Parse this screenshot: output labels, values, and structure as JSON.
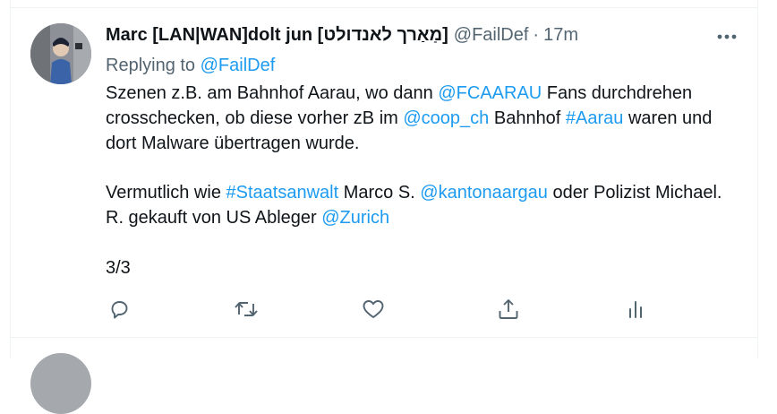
{
  "tweet": {
    "display_name": "Marc [LAN|WAN]dolt jun [מַאַרך לאנדולט]",
    "handle": "@FailDef",
    "separator": "·",
    "time": "17m",
    "replying_prefix": "Replying to",
    "replying_to": "@FailDef",
    "paragraph1": {
      "t1": "Szenen z.B. am Bahnhof Aarau, wo dann ",
      "m1": "@FCAARAU",
      "t2": " Fans durchdrehen crosschecken, ob diese vorher zB im ",
      "m2": "@coop_ch",
      "t3": " Bahnhof ",
      "h1": "#Aarau",
      "t4": " waren und dort Malware übertragen wurde."
    },
    "paragraph2": {
      "t1": "Vermutlich wie ",
      "h1": "#Staatsanwalt",
      "t2": " Marco S. ",
      "m1": "@kantonaargau",
      "t3": " oder Polizist Michael. R. gekauft von US Ableger ",
      "m2": "@Zurich"
    },
    "paragraph3": "3/3"
  },
  "icons": {
    "more": "more-horizontal-icon",
    "reply": "reply-icon",
    "retweet": "retweet-icon",
    "like": "heart-icon",
    "share": "share-icon",
    "analytics": "analytics-icon"
  },
  "colors": {
    "text": "#0f1419",
    "secondary": "#536471",
    "link": "#1d9bf0",
    "border": "#eff3f4"
  }
}
